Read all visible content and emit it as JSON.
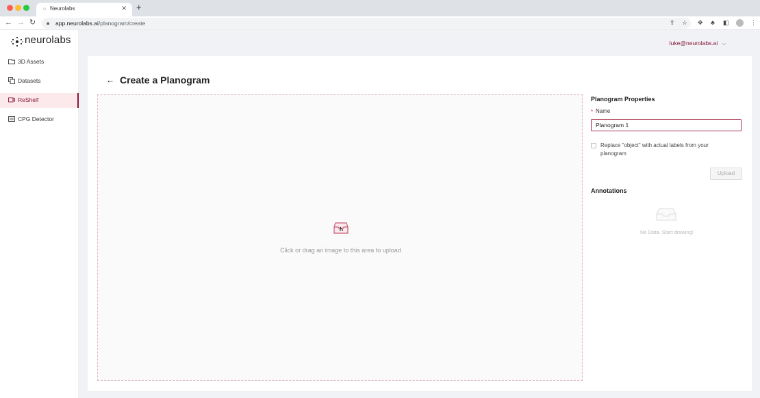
{
  "browser": {
    "tab_title": "Neurolabs",
    "tab_favicon": "neurolabs-favicon",
    "url_host": "app.neurolabs.ai",
    "url_path": "/planogram/create"
  },
  "app": {
    "logo_text": "neurolabs",
    "user_email": "luke@neurolabs.ai",
    "accent_color": "#8a1538"
  },
  "sidebar": {
    "items": [
      {
        "label": "3D Assets",
        "icon": "folder-icon",
        "active": false
      },
      {
        "label": "Datasets",
        "icon": "copy-icon",
        "active": false
      },
      {
        "label": "ReShelf",
        "icon": "video-icon",
        "active": true
      },
      {
        "label": "CPG Detector",
        "icon": "detector-icon",
        "active": false
      }
    ]
  },
  "page": {
    "title": "Create a Planogram"
  },
  "dropzone": {
    "text": "Click or drag an image to this area to upload",
    "icon": "inbox-upload-icon"
  },
  "properties": {
    "title": "Planogram Properties",
    "required_mark": "*",
    "name_label": "Name",
    "name_value": "Planogram 1",
    "checkbox_label": "Replace \"object\" with actual labels from your planogram",
    "checkbox_checked": false,
    "upload_label": "Upload"
  },
  "annotations": {
    "title": "Annotations",
    "empty_text": "No Data. Start drawing!"
  }
}
